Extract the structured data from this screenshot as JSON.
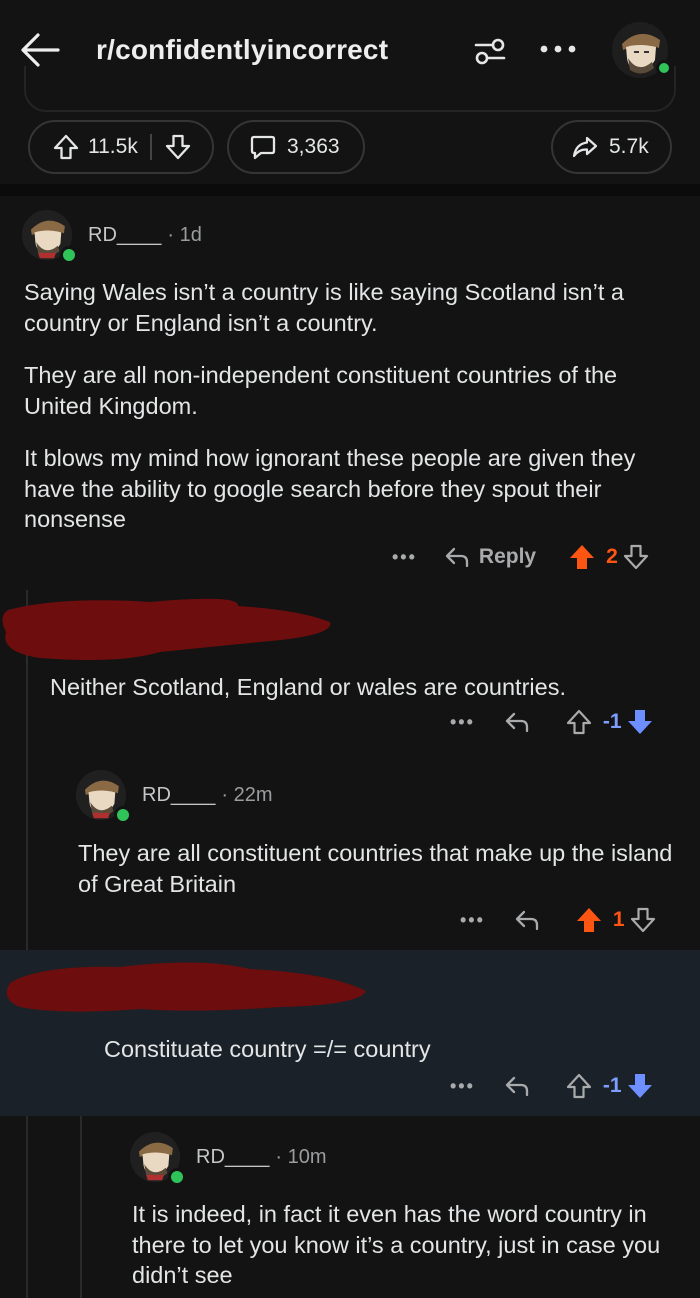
{
  "header": {
    "subreddit": "r/confidentlyincorrect"
  },
  "post_actions": {
    "upvotes": "11.5k",
    "comments": "3,363",
    "shares": "5.7k"
  },
  "comments": [
    {
      "author": "RD____",
      "time": "· 1d",
      "paragraphs": [
        "Saying Wales isn’t a country is like saying Scotland isn’t a country or England isn’t a country.",
        "They are all non-independent constituent countries of the United Kingdom.",
        "It blows my mind how ignorant these people are given they have the ability to google search before they spout their nonsense"
      ],
      "reply_label": "Reply",
      "score": "2"
    },
    {
      "author": "",
      "text": "Neither Scotland, England or wales are countries.",
      "score": "-1"
    },
    {
      "author": "RD____",
      "time": "· 22m",
      "text": "They are all constituent countries that make up the island of Great Britain",
      "score": "1"
    },
    {
      "author": "",
      "text": "Constituate country =/= country",
      "score": "-1"
    },
    {
      "author": "RD____",
      "time": "· 10m",
      "text": "It is indeed, in fact it even has the word country in there to let you know it’s a country, just in case you didn’t see"
    }
  ],
  "colors": {
    "upvote_active": "#ff5513",
    "downvote_active": "#7e9eff",
    "online": "#2fc35a",
    "highlight_bg": "#1a2128"
  }
}
